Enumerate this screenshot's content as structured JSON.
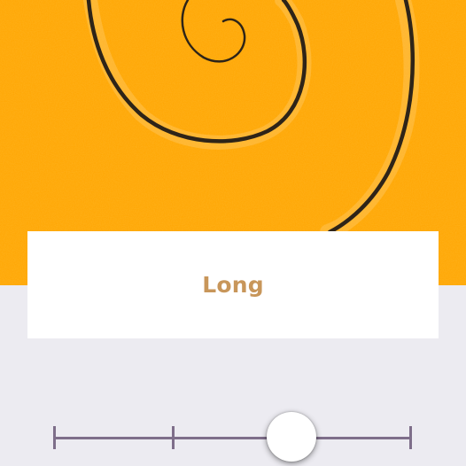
{
  "colors": {
    "hero_background": "#FFA500",
    "page_background": "#ECEBF1",
    "card_background": "#FFFFFF",
    "label_color": "#C8965A",
    "slider_color": "#7E6E8A",
    "spiral_stroke": "#2E2418"
  },
  "hero": {
    "icon": "spiral-drawing"
  },
  "card": {
    "label": "Long"
  },
  "slider": {
    "stops": 4,
    "selected_index": 2
  }
}
